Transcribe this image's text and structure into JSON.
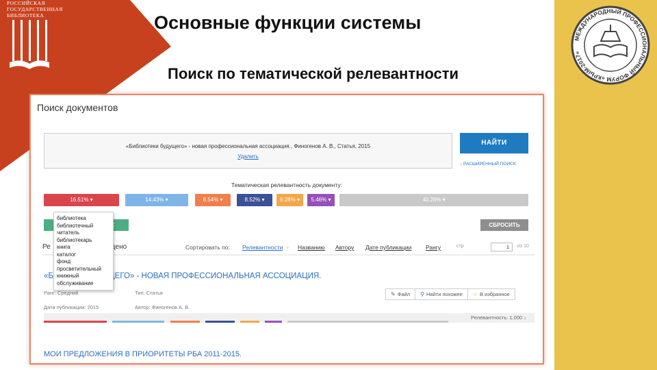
{
  "slide": {
    "title": "Основные функции системы",
    "subtitle": "Поиск по тематической релевантности",
    "logo_lines": [
      "РОССИЙСКАЯ",
      "ГОСУДАРСТВЕННАЯ",
      "БИБЛИОТЕКА"
    ],
    "seal_text": "МЕЖДУНАРОДНЫЙ ПРОФЕССИОНАЛЬНЫЙ ФОРУМ «КРЫМ-2017»",
    "colors": {
      "brand_red": "#c8411e",
      "gold": "#eac34c"
    }
  },
  "app": {
    "panel_title": "Поиск документов",
    "query": "«Библиотеки будущего» - новая профессиональная ассоциация., Финогенов А. В., Статья, 2015",
    "delete_link": "Удалить",
    "find_button": "НАЙТИ",
    "advanced_link": "↓ РАСШИРЕННЫЙ ПОИСК",
    "relevance_title": "Тематическая релевантность документу:",
    "segments": [
      {
        "label": "16.51% ▾",
        "color": "#d9454a"
      },
      {
        "label": "14.43% ▾",
        "color": "#7fb5e6"
      },
      {
        "label": "8.54% ▾",
        "color": "#f07f4c"
      },
      {
        "label": "8.52% ▾",
        "color": "#3b5196"
      },
      {
        "label": "6.28% ▾",
        "color": "#f3a64a"
      },
      {
        "label": "5.46% ▾",
        "color": "#9551b8"
      },
      {
        "label": "40.26% ▾",
        "color": "#c9c9c9"
      }
    ],
    "green_button": "ОС",
    "reset_button": "СБРОСИТЬ",
    "sort": {
      "found_label": "Ре",
      "found_suffix": "найдено",
      "sort_by": "Сортировать по:",
      "options": [
        "Релевантности",
        "Названию",
        "Автору",
        "Дате публикации",
        "Рангу"
      ],
      "page_label": "стр",
      "page_value": "1",
      "page_total": "из 10"
    },
    "dropdown_items": [
      "библиотека",
      "библиотечный",
      "читатель",
      "библиотекарь",
      "книга",
      "каталог",
      "фонд",
      "просветительный",
      "книжный",
      "обслуживание"
    ],
    "result": {
      "title_start": "«Б",
      "title_end": "УДУЩЕГО» - НОВАЯ ПРОФЕССИОНАЛЬНАЯ АССОЦИАЦИЯ.",
      "rank": "Ранг: Средний",
      "type": "Тип: Статья",
      "date": "Дата публикации: 2015",
      "author": "Автор: Финогенов А. В.",
      "actions": [
        {
          "icon": "✎",
          "label": "Файл"
        },
        {
          "icon": "⚲",
          "label": "Найти похожее"
        },
        {
          "icon": "☆",
          "label": "В избранное"
        }
      ],
      "relevance": "Релевантность: 1.000  ↓"
    },
    "result2_title": "МОИ ПРЕДЛОЖЕНИЯ В ПРИОРИТЕТЫ РБА 2011-2015."
  }
}
